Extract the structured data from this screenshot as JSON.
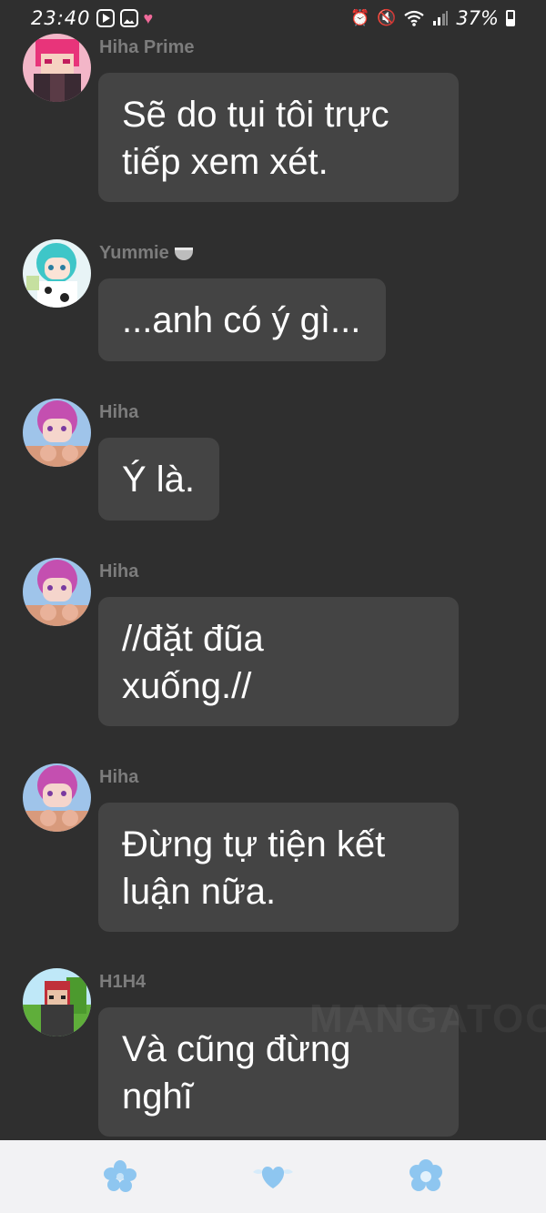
{
  "status_bar": {
    "time": "23:40",
    "battery": "37%",
    "icons": [
      "youtube-icon",
      "gallery-icon",
      "heart-icon",
      "alarm-icon",
      "mute-icon",
      "wifi-icon",
      "signal-icon",
      "battery-icon"
    ]
  },
  "messages": [
    {
      "sender": "Hiha Prime",
      "text": "Sẽ do tụi tôi trực\ntiếp xem xét.",
      "avatar": "avatar-pink-hair"
    },
    {
      "sender": "Yummie",
      "sender_emoji": "cup-icon",
      "text": "...anh có ý gì...",
      "avatar": "avatar-teal-hair"
    },
    {
      "sender": "Hiha",
      "text": "Ý là.",
      "avatar": "avatar-pink-anime"
    },
    {
      "sender": "Hiha",
      "text": "//đặt đũa\nxuống.//",
      "avatar": "avatar-pink-anime"
    },
    {
      "sender": "Hiha",
      "text": "Đừng tự tiện kết\nluận nữa.",
      "avatar": "avatar-pink-anime"
    },
    {
      "sender": "H1H4",
      "text": "Và cũng đừng\nnghĩ",
      "avatar": "avatar-minecraft"
    }
  ],
  "watermark": "MANGATOON",
  "bottom_nav": {
    "items": [
      "flower-icon",
      "heart-wings-icon",
      "flower-round-icon"
    ],
    "accent": "#8ec6f0"
  }
}
